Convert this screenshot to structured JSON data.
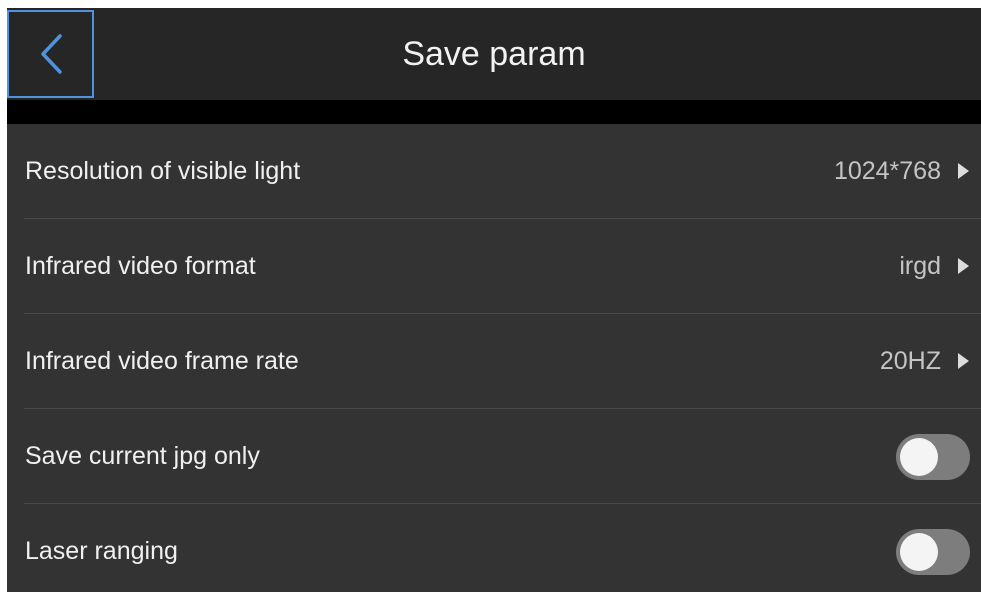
{
  "header": {
    "title": "Save param",
    "back_icon": "chevron-left-icon",
    "accent_color": "#4f93df"
  },
  "settings": [
    {
      "label": "Resolution of visible light",
      "value": "1024*768",
      "type": "select"
    },
    {
      "label": "Infrared video format",
      "value": "irgd",
      "type": "select"
    },
    {
      "label": "Infrared video frame rate",
      "value": "20HZ",
      "type": "select"
    },
    {
      "label": "Save current jpg only",
      "type": "toggle",
      "on": false
    },
    {
      "label": "Laser ranging",
      "type": "toggle",
      "on": false
    }
  ]
}
